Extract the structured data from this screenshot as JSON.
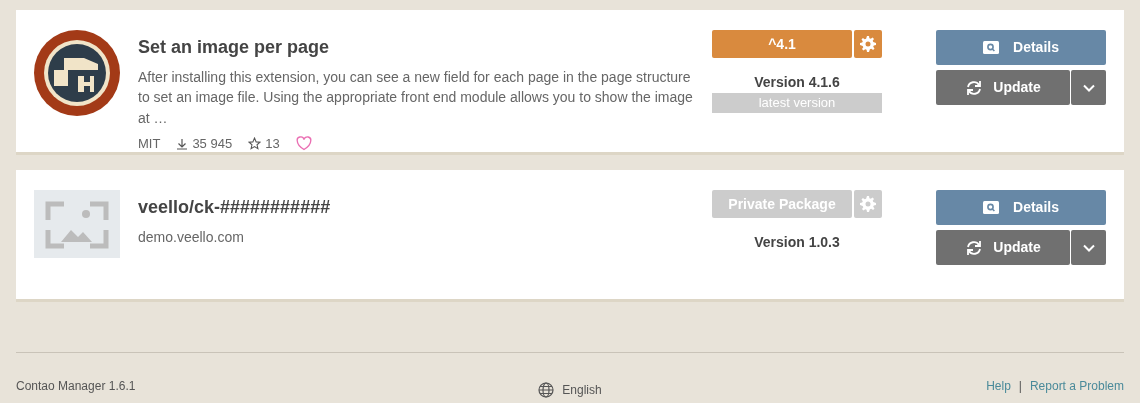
{
  "packages": [
    {
      "kind": "public",
      "title": "Set an image per page",
      "description": "After installing this extension, you can see a new field for each page in the page structure to set an image file. Using the appropriate front end module allows you to show the image at …",
      "license": "MIT",
      "downloads": "35 945",
      "stars_count": "13",
      "favorite": false,
      "constraint": "^4.1",
      "version": "Version 4.1.6",
      "version_note": "latest version",
      "details": "Details",
      "action": "Update"
    },
    {
      "kind": "private",
      "title": "veello/ck-###########",
      "description": "demo.veello.com",
      "constraint": "Private Package",
      "version": "Version 1.0.3",
      "details": "Details",
      "action": "Update"
    }
  ],
  "footer": {
    "app": "Contao Manager 1.6.1",
    "language": "English",
    "links": [
      "Help",
      "Report a Problem"
    ],
    "separator": "|"
  }
}
